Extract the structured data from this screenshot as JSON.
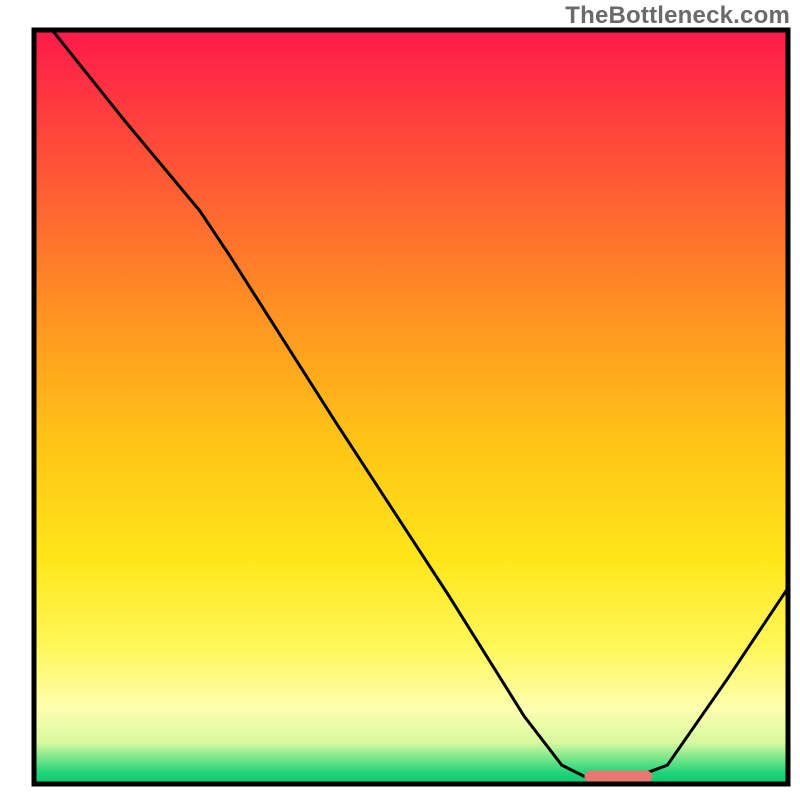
{
  "watermark": "TheBottleneck.com",
  "chart_data": {
    "type": "line",
    "title": "",
    "xlabel": "",
    "ylabel": "",
    "xlim": [
      0,
      100
    ],
    "ylim": [
      0,
      100
    ],
    "curve": [
      {
        "x": 0,
        "y": 103
      },
      {
        "x": 12,
        "y": 88
      },
      {
        "x": 22,
        "y": 76
      },
      {
        "x": 26,
        "y": 70
      },
      {
        "x": 40,
        "y": 48
      },
      {
        "x": 55,
        "y": 25
      },
      {
        "x": 65,
        "y": 9
      },
      {
        "x": 70,
        "y": 2.5
      },
      {
        "x": 73,
        "y": 1.0
      },
      {
        "x": 80,
        "y": 1.0
      },
      {
        "x": 84,
        "y": 2.5
      },
      {
        "x": 92,
        "y": 14
      },
      {
        "x": 100,
        "y": 26
      }
    ],
    "optimal_marker": {
      "x_start": 73,
      "x_end": 82,
      "y": 1.0
    },
    "gradient_stops": [
      {
        "offset": 0.0,
        "color": "#ff1a4b"
      },
      {
        "offset": 0.1,
        "color": "#ff3a3f"
      },
      {
        "offset": 0.25,
        "color": "#ff6a2f"
      },
      {
        "offset": 0.4,
        "color": "#ff9a1f"
      },
      {
        "offset": 0.55,
        "color": "#ffc516"
      },
      {
        "offset": 0.7,
        "color": "#ffe61a"
      },
      {
        "offset": 0.82,
        "color": "#fff85a"
      },
      {
        "offset": 0.9,
        "color": "#fdffb0"
      },
      {
        "offset": 0.945,
        "color": "#d8f8a0"
      },
      {
        "offset": 0.965,
        "color": "#7ce88a"
      },
      {
        "offset": 0.985,
        "color": "#20d47a"
      },
      {
        "offset": 1.0,
        "color": "#0acb6f"
      }
    ],
    "frame_stroke": "#000000",
    "curve_stroke": "#000000",
    "marker_fill": "#e8786f"
  }
}
